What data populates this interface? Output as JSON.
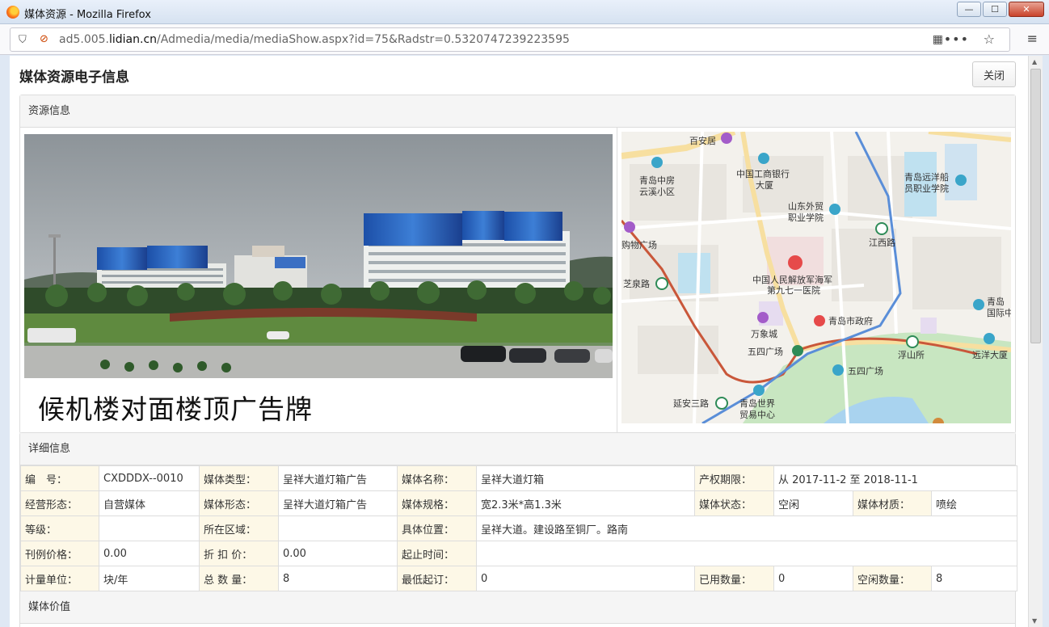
{
  "window": {
    "title": "媒体资源 - Mozilla Firefox",
    "minimize": "—",
    "maximize": "☐",
    "close": "✕"
  },
  "address": {
    "url_prefix": "ad5.005.",
    "url_domain": "lidian.cn",
    "url_path": "/Admedia/media/mediaShow.aspx?id=75&Radstr=0.5320747239223595"
  },
  "icons": {
    "shield": "⛉",
    "nolock": "🔓",
    "qr": "▦",
    "more": "•••",
    "bookmark": "☆",
    "menu": "≡"
  },
  "page": {
    "title": "媒体资源电子信息",
    "close_label": "关闭"
  },
  "resource": {
    "header": "资源信息",
    "photo_caption": "候机楼对面楼顶广告牌"
  },
  "map": {
    "labels": [
      "百安居",
      "青岛中房",
      "云溪小区",
      "中国工商银行",
      "大厦",
      "青岛远洋船",
      "员职业学院",
      "山东外贸",
      "职业学院",
      "购物广场",
      "江西路",
      "芝泉路",
      "中国人民解放军海军",
      "第九七一医院",
      "青岛",
      "国际中",
      "万象城",
      "青岛市政府",
      "五四广场",
      "浮山所",
      "远洋大厦",
      "五四广场",
      "延安三路",
      "青岛世界",
      "贸易中心"
    ]
  },
  "detail": {
    "header": "详细信息",
    "rows": [
      [
        {
          "t": "lbl",
          "v": "编　号："
        },
        {
          "t": "val",
          "v": "CXDDDX--0010"
        },
        {
          "t": "lbl",
          "v": "媒体类型："
        },
        {
          "t": "val",
          "v": "呈祥大道灯箱广告"
        },
        {
          "t": "lbl",
          "v": "媒体名称："
        },
        {
          "t": "val",
          "v": "呈祥大道灯箱"
        },
        {
          "t": "lbl",
          "v": "产权期限："
        },
        {
          "t": "val",
          "v": "从 2017-11-2 至 2018-11-1",
          "span": 3
        }
      ],
      [
        {
          "t": "lbl",
          "v": "经营形态："
        },
        {
          "t": "val",
          "v": "自营媒体"
        },
        {
          "t": "lbl",
          "v": "媒体形态："
        },
        {
          "t": "val",
          "v": "呈祥大道灯箱广告"
        },
        {
          "t": "lbl",
          "v": "媒体规格："
        },
        {
          "t": "val",
          "v": "宽2.3米*高1.3米"
        },
        {
          "t": "lbl",
          "v": "媒体状态："
        },
        {
          "t": "val",
          "v": "空闲"
        },
        {
          "t": "lbl",
          "v": "媒体材质："
        },
        {
          "t": "val",
          "v": "喷绘"
        }
      ],
      [
        {
          "t": "lbl",
          "v": "等级："
        },
        {
          "t": "val",
          "v": ""
        },
        {
          "t": "lbl",
          "v": "所在区域："
        },
        {
          "t": "val",
          "v": ""
        },
        {
          "t": "lbl",
          "v": "具体位置："
        },
        {
          "t": "val",
          "v": "呈祥大道。建设路至铜厂。路南",
          "span": 5
        }
      ],
      [
        {
          "t": "lbl",
          "v": "刊例价格："
        },
        {
          "t": "val",
          "v": "0.00"
        },
        {
          "t": "lbl",
          "v": "折 扣 价："
        },
        {
          "t": "val",
          "v": "0.00"
        },
        {
          "t": "lbl",
          "v": "起止时间："
        },
        {
          "t": "val",
          "v": "",
          "span": 5
        }
      ],
      [
        {
          "t": "lbl",
          "v": "计量单位："
        },
        {
          "t": "val",
          "v": "块/年"
        },
        {
          "t": "lbl",
          "v": "总 数 量："
        },
        {
          "t": "val",
          "v": "8"
        },
        {
          "t": "lbl",
          "v": "最低起订："
        },
        {
          "t": "val",
          "v": "0"
        },
        {
          "t": "lbl",
          "v": "已用数量："
        },
        {
          "t": "val",
          "v": "0"
        },
        {
          "t": "lbl",
          "v": "空闲数量："
        },
        {
          "t": "val",
          "v": "8"
        }
      ]
    ]
  },
  "value": {
    "header": "媒体价值"
  }
}
